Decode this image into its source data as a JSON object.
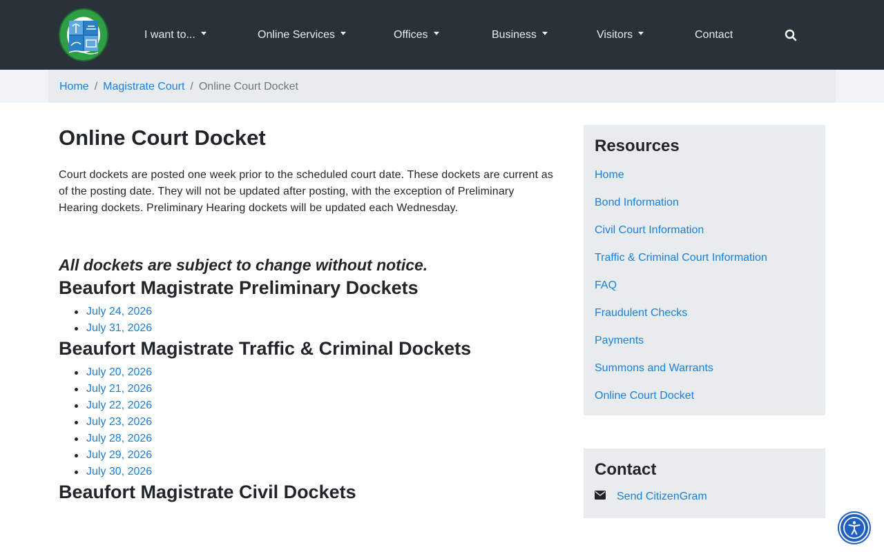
{
  "site": {
    "logo_text": "BEAUFORT COUNTY SOUTH CAROLINA 1769"
  },
  "nav": {
    "items": [
      {
        "label": "I want to...",
        "dropdown": true
      },
      {
        "label": "Online Services",
        "dropdown": true
      },
      {
        "label": "Offices",
        "dropdown": true
      },
      {
        "label": "Business",
        "dropdown": true
      },
      {
        "label": "Visitors",
        "dropdown": true
      },
      {
        "label": "Contact",
        "dropdown": false
      }
    ],
    "search_icon": "search-icon"
  },
  "breadcrumb": {
    "items": [
      "Home",
      "Magistrate Court"
    ],
    "current": "Online Court Docket",
    "separator": "/"
  },
  "main": {
    "title": "Online Court Docket",
    "intro": "Court dockets are posted one week prior to the scheduled court date. These dockets are current as of the posting date. They will not be updated after posting, with the exception of Preliminary Hearing dockets. Preliminary Hearing dockets will be updated each Wednesday.",
    "notice": "All dockets are subject to change without notice.",
    "sections": [
      {
        "heading": "Beaufort Magistrate Preliminary Dockets",
        "dates": [
          "July 24, 2026",
          "July 31, 2026"
        ]
      },
      {
        "heading": "Beaufort Magistrate Traffic & Criminal Dockets",
        "dates": [
          "July 20, 2026",
          "July 21, 2026",
          "July 22, 2026",
          "July 23, 2026",
          "July 28, 2026",
          "July 29, 2026",
          "July 30, 2026"
        ]
      },
      {
        "heading": "Beaufort Magistrate Civil Dockets",
        "dates": []
      }
    ]
  },
  "sidebar": {
    "resources": {
      "title": "Resources",
      "links": [
        "Home",
        "Bond Information",
        "Civil Court Information",
        "Traffic & Criminal Court Information",
        "FAQ",
        "Fraudulent Checks",
        "Payments",
        "Summons and Warrants",
        "Online Court Docket"
      ]
    },
    "contact": {
      "title": "Contact",
      "link": "Send CitizenGram",
      "icon": "envelope-icon"
    }
  },
  "colors": {
    "nav_bg": "#283238",
    "link": "#1a7ed8",
    "card_bg": "#e9ecef",
    "accessibility_btn": "#1f5fbf"
  }
}
